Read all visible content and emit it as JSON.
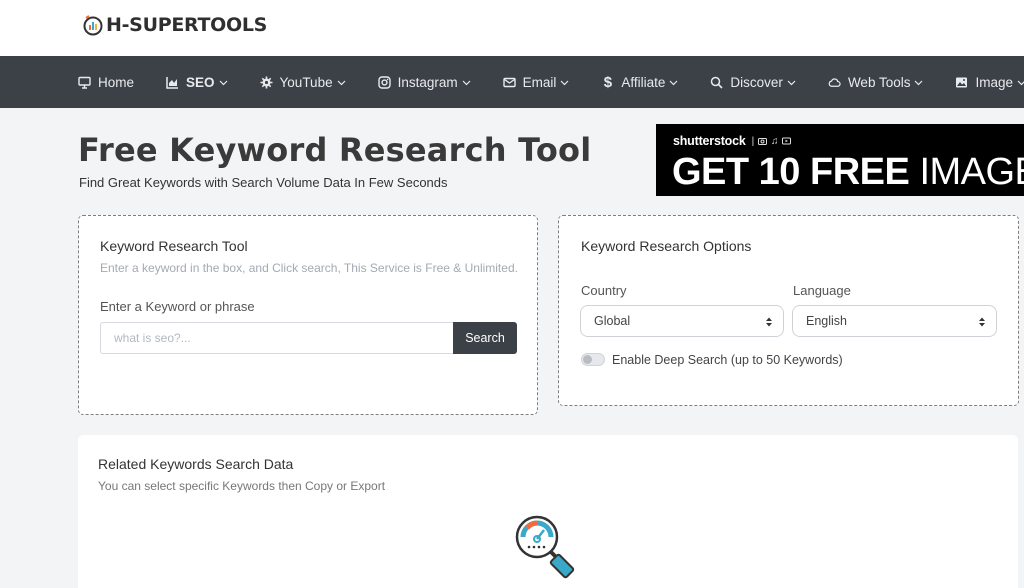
{
  "brand": {
    "name": "H-SUPERTOOLS"
  },
  "nav": {
    "items": [
      {
        "label": "Home",
        "icon": "monitor-icon",
        "dropdown": false
      },
      {
        "label": "SEO",
        "icon": "chart-icon",
        "dropdown": true
      },
      {
        "label": "YouTube",
        "icon": "gear-icon",
        "dropdown": true
      },
      {
        "label": "Instagram",
        "icon": "instagram-icon",
        "dropdown": true
      },
      {
        "label": "Email",
        "icon": "envelope-icon",
        "dropdown": true
      },
      {
        "label": "Affiliate",
        "icon": "dollar-icon",
        "dropdown": true
      },
      {
        "label": "Discover",
        "icon": "search-icon",
        "dropdown": true
      },
      {
        "label": "Web Tools",
        "icon": "cloud-icon",
        "dropdown": true
      },
      {
        "label": "Image",
        "icon": "image-icon",
        "dropdown": true
      }
    ]
  },
  "header": {
    "title": "Free Keyword Research Tool",
    "subtitle": "Find Great Keywords with Search Volume Data In Few Seconds"
  },
  "ad": {
    "brand": "shutterstock",
    "headline_num": "GET 10",
    "headline_bold": "FREE",
    "headline_rest": "IMAGES"
  },
  "tool": {
    "title": "Keyword Research Tool",
    "description": "Enter a keyword in the box, and Click search, This Service is Free & Unlimited.",
    "input_label": "Enter a Keyword or phrase",
    "input_placeholder": "what is seo?...",
    "input_value": "",
    "search_label": "Search"
  },
  "options": {
    "title": "Keyword Research Options",
    "country_label": "Country",
    "country_value": "Global",
    "language_label": "Language",
    "language_value": "English",
    "deep_search_label": "Enable Deep Search (up to 50 Keywords)",
    "deep_search_on": false
  },
  "related": {
    "title": "Related Keywords Search Data",
    "description": "You can select specific Keywords then Copy or Export"
  },
  "colors": {
    "nav_bg": "#3c4148",
    "page_bg": "#f3f4f6",
    "accent_teal": "#3aa9c9",
    "accent_orange": "#f26b3a"
  }
}
